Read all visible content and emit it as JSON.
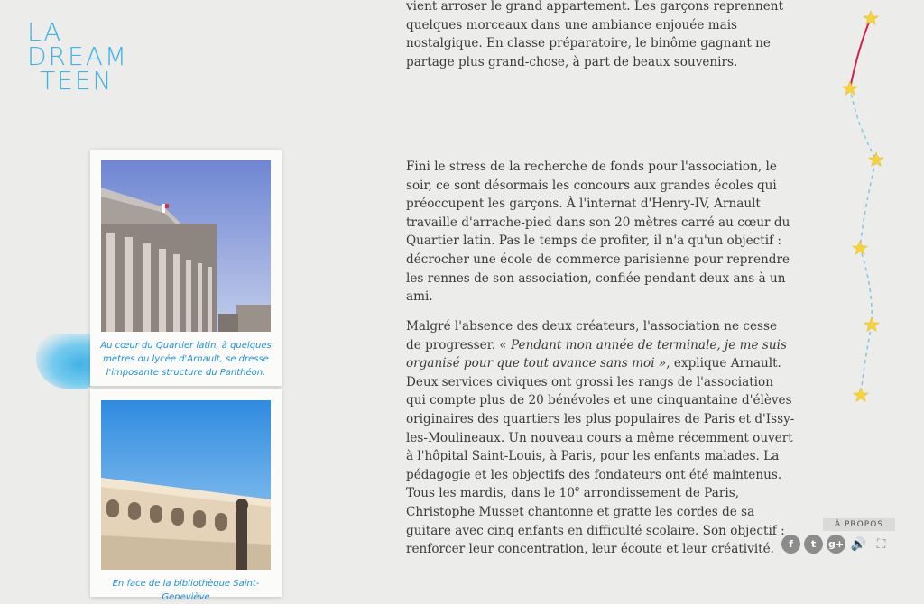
{
  "logo": {
    "line1": "LA",
    "line2": "DREAM",
    "line3": "TEEN"
  },
  "photos": [
    {
      "caption": "Au cœur du Quartier latin, à quelques mètres du lycée d'Arnault, se dresse l'imposante structure du Panthéon."
    },
    {
      "caption": "En face de la bibliothèque Saint-Geneviève"
    }
  ],
  "article": {
    "p1": "vient arroser le grand appartement. Les garçons reprennent quelques morceaux dans une ambiance enjouée mais nostalgique. En classe préparatoire, le binôme gagnant ne partage plus grand-chose, à part de beaux souvenirs.",
    "p2": "Fini le stress de la recherche de fonds pour l'association, le soir, ce sont désormais les concours aux grandes écoles qui préoccupent les garçons. À l'internat d'Henry-IV, Arnault travaille d'arrache-pied dans son 20 mètres carré au cœur du Quartier latin. Pas le temps de profiter, il n'a qu'un objectif : décrocher une école de commerce parisienne pour reprendre les rennes de son association, confiée pendant deux ans à un ami.",
    "p3_a": "Malgré l'absence des deux créateurs, l'association ne cesse de progresser.",
    "p3_quote": "« Pendant mon année de terminale, je me suis organisé pour que tout avance sans moi »",
    "p3_b": ", explique Arnault. Deux services civiques ont grossi les rangs de l'association qui compte plus de 20 bénévoles et une cinquantaine d'élèves originaires des quartiers les plus populaires de Paris et d'Issy-les-Moulineaux. Un nouveau cours a même récemment ouvert à l'hôpital Saint-Louis, à Paris, pour les enfants malades. La pédagogie et les objectifs des fondateurs ont été maintenus. Tous les mardis, dans le 10",
    "p3_sup": "e",
    "p3_c": " arrondissement de Paris, Christophe Musset chantonne et gratte les cordes de sa guitare avec cinq enfants en difficulté scolaire. Son objectif : renforcer leur concentration, leur écoute et leur créativité."
  },
  "footer": {
    "about_label": "À PROPOS",
    "social": [
      {
        "icon": "facebook-icon",
        "glyph": "f"
      },
      {
        "icon": "twitter-icon",
        "glyph": "t"
      },
      {
        "icon": "google-plus-icon",
        "glyph": "g+"
      },
      {
        "icon": "sound-icon",
        "glyph": "🔊"
      },
      {
        "icon": "fullscreen-icon",
        "glyph": "⛶"
      }
    ]
  },
  "colors": {
    "accent": "#3fb4e6",
    "star": "#f5d43a",
    "progress": "#d21f4f",
    "dash": "#7fc6e6"
  }
}
